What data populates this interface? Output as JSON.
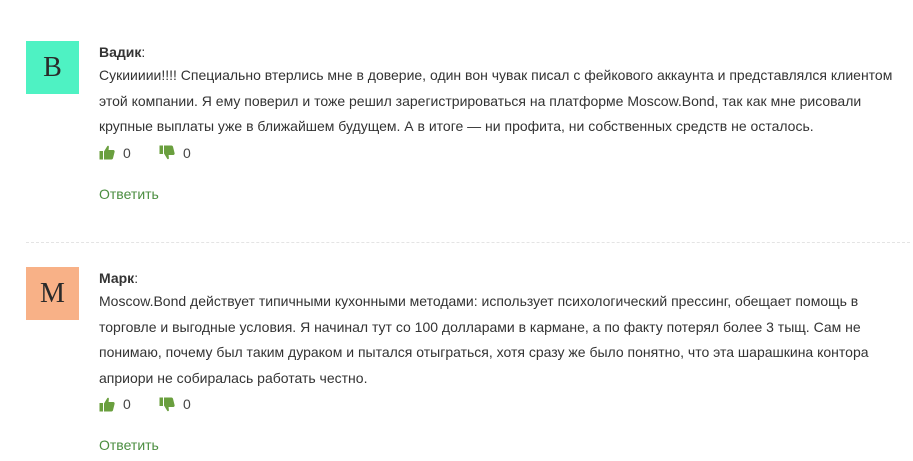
{
  "comments": [
    {
      "avatar_letter": "В",
      "avatar_color": "#4ef2c3",
      "author": "Вадик",
      "text": "Сукиииии!!!! Специально втерлись мне в доверие, один вон чувак писал с фейкового аккаунта и представлялся клиентом этой компании. Я ему поверил и тоже решил зарегистрироваться на платформе Moscow.Bond, так как мне рисовали крупные выплаты уже в ближайшем будущем. А в итоге — ни профита, ни собственных средств не осталось.",
      "likes": "0",
      "dislikes": "0",
      "reply_label": "Ответить"
    },
    {
      "avatar_letter": "М",
      "avatar_color": "#f8b187",
      "author": "Марк",
      "text": "Moscow.Bond действует типичными кухонными методами: использует психологический прессинг, обещает помощь в торговле и выгодные условия. Я начинал тут со 100 долларами в кармане, а по факту потерял более 3 тыщ. Сам не понимаю, почему был таким дураком и пытался отыграться, хотя сразу же было понятно, что эта шарашкина контора априори не собиралась работать честно.",
      "likes": "0",
      "dislikes": "0",
      "reply_label": "Ответить"
    }
  ],
  "colors": {
    "vote_icon": "#6a9f3e",
    "reply_link": "#4b8e40",
    "separator": "#e4e4e4"
  },
  "icons": {
    "like": "thumbs-up-icon",
    "dislike": "thumbs-down-icon"
  }
}
